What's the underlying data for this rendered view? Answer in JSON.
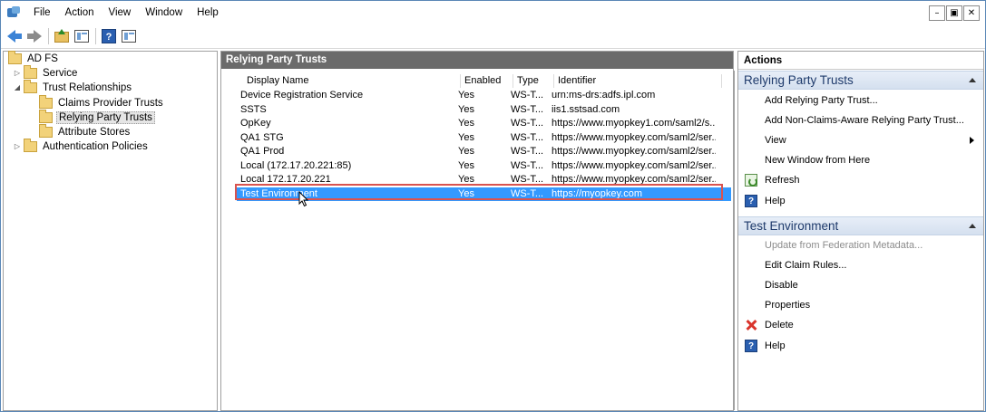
{
  "menu": {
    "items": [
      "File",
      "Action",
      "View",
      "Window",
      "Help"
    ]
  },
  "window_controls": {
    "minimize": "–",
    "restore": "▣",
    "close": "✕"
  },
  "tree": {
    "root": "AD FS",
    "service": "Service",
    "trust_relationships": "Trust Relationships",
    "claims_provider_trusts": "Claims Provider Trusts",
    "relying_party_trusts": "Relying Party Trusts",
    "attribute_stores": "Attribute Stores",
    "authentication_policies": "Authentication Policies"
  },
  "center": {
    "title": "Relying Party Trusts",
    "columns": [
      "Display Name",
      "Enabled",
      "Type",
      "Identifier"
    ],
    "rows": [
      [
        "Device Registration Service",
        "Yes",
        "WS-T...",
        "urn:ms-drs:adfs.ipl.com"
      ],
      [
        "SSTS",
        "Yes",
        "WS-T...",
        "iis1.sstsad.com"
      ],
      [
        "OpKey",
        "Yes",
        "WS-T...",
        "https://www.myopkey1.com/saml2/s..."
      ],
      [
        "QA1 STG",
        "Yes",
        "WS-T...",
        "https://www.myopkey.com/saml2/ser..."
      ],
      [
        "QA1 Prod",
        "Yes",
        "WS-T...",
        "https://www.myopkey.com/saml2/ser..."
      ],
      [
        "Local (172.17.20.221:85)",
        "Yes",
        "WS-T...",
        "https://www.myopkey.com/saml2/ser..."
      ],
      [
        "Local 172.17.20.221",
        "Yes",
        "WS-T...",
        "https://www.myopkey.com/saml2/ser..."
      ],
      [
        "Test Environment",
        "Yes",
        "WS-T...",
        "https://myopkey.com"
      ]
    ],
    "selected_row": 7
  },
  "actions": {
    "title": "Actions",
    "section1": {
      "title": "Relying Party Trusts",
      "items": [
        "Add Relying Party Trust...",
        "Add Non-Claims-Aware Relying Party Trust...",
        "View",
        "New Window from Here",
        "Refresh",
        "Help"
      ]
    },
    "section2": {
      "title": "Test Environment",
      "items": [
        "Update from Federation Metadata...",
        "Edit Claim Rules...",
        "Disable",
        "Properties",
        "Delete",
        "Help"
      ]
    }
  },
  "colors": {
    "selection": "#3399ff",
    "highlight_outline": "#d9534f",
    "section_header": "#d5e0ef"
  },
  "icons": {
    "app": "adfs-icon",
    "back": "back-arrow-icon",
    "forward": "forward-arrow-icon",
    "up": "folder-up-icon",
    "console_tree": "show-hide-tree-icon",
    "help": "help-icon",
    "action_pane": "show-hide-action-pane-icon"
  }
}
